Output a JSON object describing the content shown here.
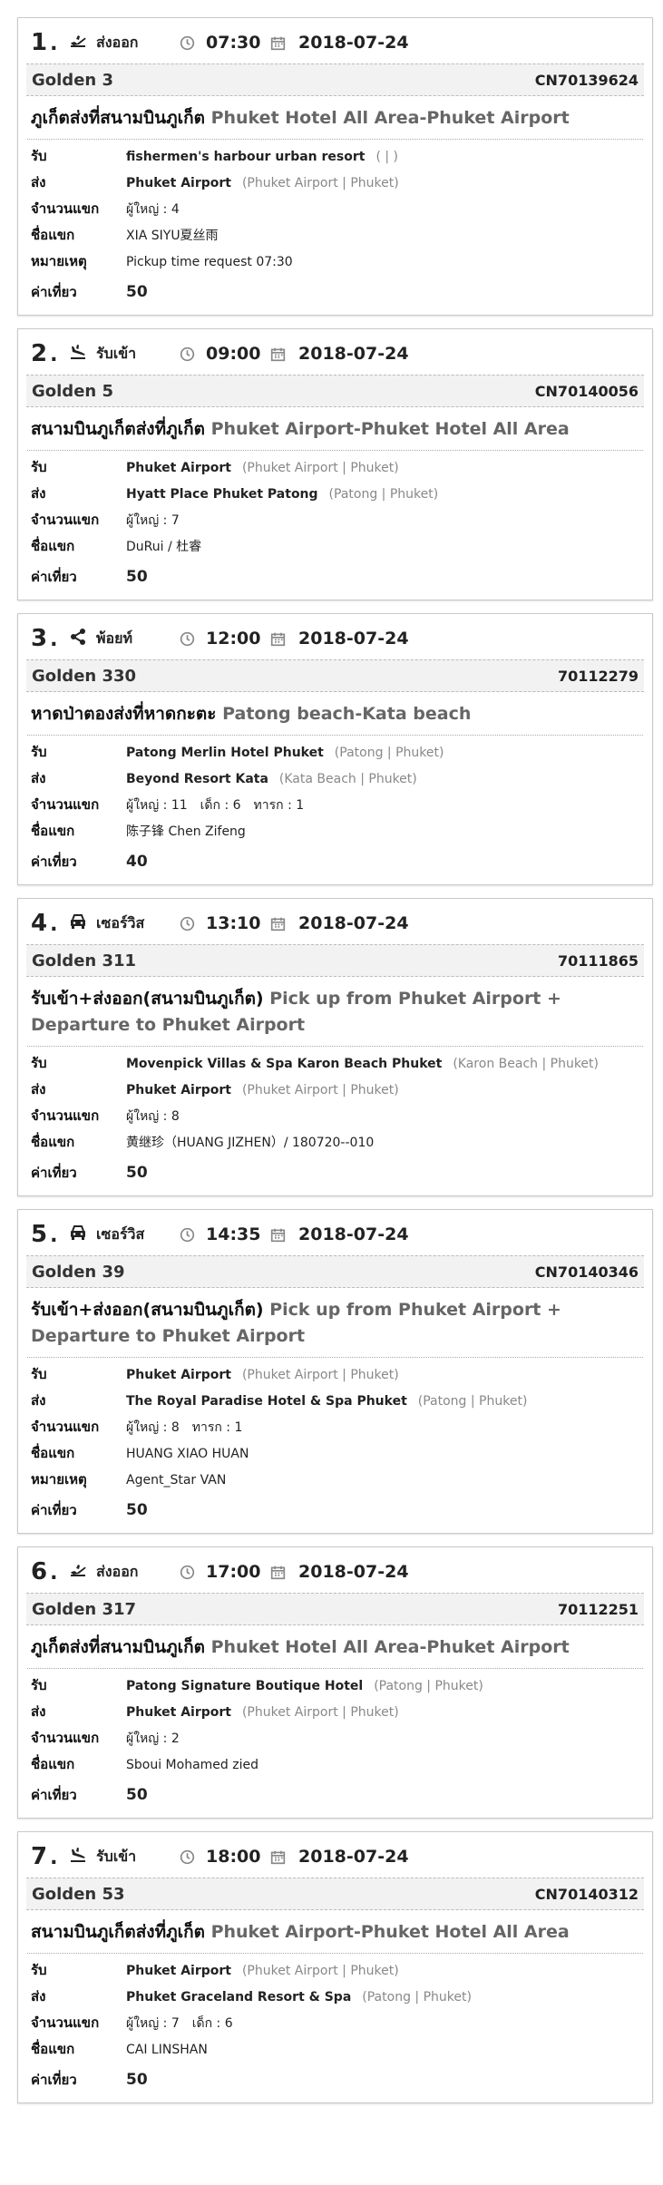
{
  "labels": {
    "pickup": "รับ",
    "dropoff": "ส่ง",
    "guests": "จำนวนแขก",
    "guest_name": "ชื่อแขก",
    "note": "หมายเหตุ",
    "fare": "ค่าเที่ยว"
  },
  "jobs": [
    {
      "num": "1",
      "dot": ".",
      "type_icon": "plane-takeoff-icon",
      "type": "ส่งออก",
      "time": "07:30",
      "date": "2018-07-24",
      "driver": "Golden 3",
      "code": "CN70139624",
      "route_th": "ภูเก็ตส่งที่สนามบินภูเก็ต",
      "route_en": "Phuket Hotel All Area-Phuket Airport",
      "pickup": "fishermen's harbour urban resort",
      "pickup_sub": "( | )",
      "dropoff": "Phuket Airport",
      "dropoff_sub": "(Phuket Airport | Phuket)",
      "counts": [
        "ผู้ใหญ่ : 4"
      ],
      "guest": "XIA SIYU夏丝雨",
      "note": "Pickup time request 07:30",
      "fare": "50"
    },
    {
      "num": "2",
      "dot": ".",
      "type_icon": "plane-landing-icon",
      "type": "รับเข้า",
      "time": "09:00",
      "date": "2018-07-24",
      "driver": "Golden 5",
      "code": "CN70140056",
      "route_th": "สนามบินภูเก็ตส่งที่ภูเก็ต",
      "route_en": "Phuket Airport-Phuket Hotel All Area",
      "pickup": "Phuket Airport",
      "pickup_sub": "(Phuket Airport | Phuket)",
      "dropoff": "Hyatt Place Phuket Patong",
      "dropoff_sub": "(Patong | Phuket)",
      "counts": [
        "ผู้ใหญ่ : 7"
      ],
      "guest": "DuRui / 杜睿",
      "note": "",
      "fare": "50"
    },
    {
      "num": "3",
      "dot": ".",
      "type_icon": "share-icon",
      "type": "พ้อยท์",
      "time": "12:00",
      "date": "2018-07-24",
      "driver": "Golden 330",
      "code": "70112279",
      "route_th": "หาดป่าตองส่งที่หาดกะตะ",
      "route_en": "Patong beach-Kata beach",
      "pickup": "Patong Merlin Hotel Phuket",
      "pickup_sub": "(Patong | Phuket)",
      "dropoff": "Beyond Resort Kata",
      "dropoff_sub": "(Kata Beach | Phuket)",
      "counts": [
        "ผู้ใหญ่ : 11",
        "เด็ก : 6",
        "ทารก : 1"
      ],
      "guest": "陈子锋 Chen Zifeng",
      "note": "",
      "fare": "40"
    },
    {
      "num": "4",
      "dot": ".",
      "type_icon": "car-icon",
      "type": "เซอร์วิส",
      "time": "13:10",
      "date": "2018-07-24",
      "driver": "Golden 311",
      "code": "70111865",
      "route_th": "รับเข้า+ส่งออก(สนามบินภูเก็ต)",
      "route_en": "Pick up from Phuket Airport + Departure to Phuket Airport",
      "pickup": "Movenpick Villas & Spa Karon Beach Phuket",
      "pickup_sub": "(Karon Beach | Phuket)",
      "dropoff": "Phuket Airport",
      "dropoff_sub": "(Phuket Airport | Phuket)",
      "counts": [
        "ผู้ใหญ่ : 8"
      ],
      "guest": "黄继珍（HUANG JIZHEN）/ 180720--010",
      "note": "",
      "fare": "50"
    },
    {
      "num": "5",
      "dot": ".",
      "type_icon": "car-icon",
      "type": "เซอร์วิส",
      "time": "14:35",
      "date": "2018-07-24",
      "driver": "Golden 39",
      "code": "CN70140346",
      "route_th": "รับเข้า+ส่งออก(สนามบินภูเก็ต)",
      "route_en": "Pick up from Phuket Airport + Departure to Phuket Airport",
      "pickup": "Phuket Airport",
      "pickup_sub": "(Phuket Airport | Phuket)",
      "dropoff": "The Royal Paradise Hotel & Spa Phuket",
      "dropoff_sub": "(Patong | Phuket)",
      "counts": [
        "ผู้ใหญ่ : 8",
        "ทารก : 1"
      ],
      "guest": "HUANG XIAO HUAN",
      "note": "Agent_Star VAN",
      "fare": "50"
    },
    {
      "num": "6",
      "dot": ".",
      "type_icon": "plane-takeoff-icon",
      "type": "ส่งออก",
      "time": "17:00",
      "date": "2018-07-24",
      "driver": "Golden 317",
      "code": "70112251",
      "route_th": "ภูเก็ตส่งที่สนามบินภูเก็ต",
      "route_en": "Phuket Hotel All Area-Phuket Airport",
      "pickup": "Patong Signature Boutique Hotel",
      "pickup_sub": "(Patong | Phuket)",
      "dropoff": "Phuket Airport",
      "dropoff_sub": "(Phuket Airport | Phuket)",
      "counts": [
        "ผู้ใหญ่ : 2"
      ],
      "guest": "Sboui Mohamed zied",
      "note": "",
      "fare": "50"
    },
    {
      "num": "7",
      "dot": ".",
      "type_icon": "plane-landing-icon",
      "type": "รับเข้า",
      "time": "18:00",
      "date": "2018-07-24",
      "driver": "Golden 53",
      "code": "CN70140312",
      "route_th": "สนามบินภูเก็ตส่งที่ภูเก็ต",
      "route_en": "Phuket Airport-Phuket Hotel All Area",
      "pickup": "Phuket Airport",
      "pickup_sub": "(Phuket Airport | Phuket)",
      "dropoff": "Phuket Graceland Resort & Spa",
      "dropoff_sub": "(Patong | Phuket)",
      "counts": [
        "ผู้ใหญ่ : 7",
        "เด็ก : 6"
      ],
      "guest": "CAI LINSHAN",
      "note": "",
      "fare": "50"
    }
  ]
}
